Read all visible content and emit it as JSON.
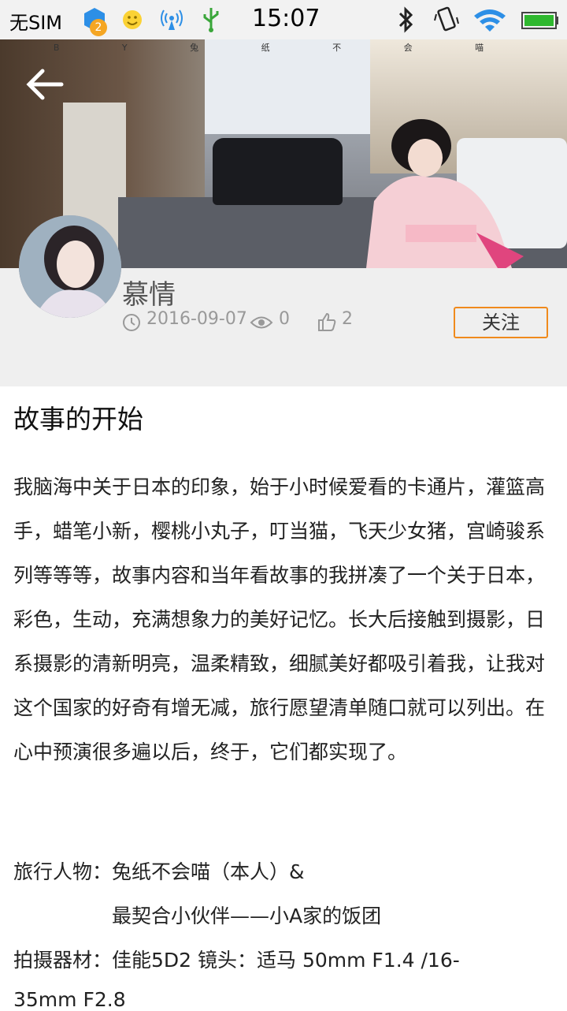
{
  "status_bar": {
    "carrier": "无SIM",
    "notification_badge": "2",
    "time": "15:07",
    "icons": [
      "notification-app-icon",
      "smiley-icon",
      "hotspot-icon",
      "usb-icon",
      "bluetooth-icon",
      "vibrate-icon",
      "wifi-icon",
      "battery-icon"
    ]
  },
  "header": {
    "banner_text": "B Y 兔 纸 不 会 喵",
    "back_icon": "back-arrow-icon"
  },
  "author": {
    "name": "慕情",
    "date": "2016-09-07",
    "views": "0",
    "likes": "2",
    "follow_label": "关注"
  },
  "article": {
    "title": "故事的开始",
    "body": "我脑海中关于日本的印象，始于小时候爱看的卡通片，灌篮高手，蜡笔小新，樱桃小丸子，叮当猫，飞天少女猪，宫崎骏系列等等等，故事内容和当年看故事的我拼凑了一个关于日本，彩色，生动，充满想象力的美好记忆。长大后接触到摄影，日系摄影的清新明亮，温柔精致，细腻美好都吸引着我，让我对这个国家的好奇有增无减，旅行愿望清单随口就可以列出。在心中预演很多遍以后，终于，它们都实现了。",
    "people_line1": "旅行人物：兔纸不会喵（本人）&",
    "people_line2": "最契合小伙伴——小A家的饭团",
    "gear_line1": "拍摄器材：佳能5D2 镜头：适马 50mm F1.4 /16-",
    "gear_line2": "35mm F2.8"
  },
  "colors": {
    "accent": "#f08a1c",
    "meta_gray": "#999999"
  }
}
